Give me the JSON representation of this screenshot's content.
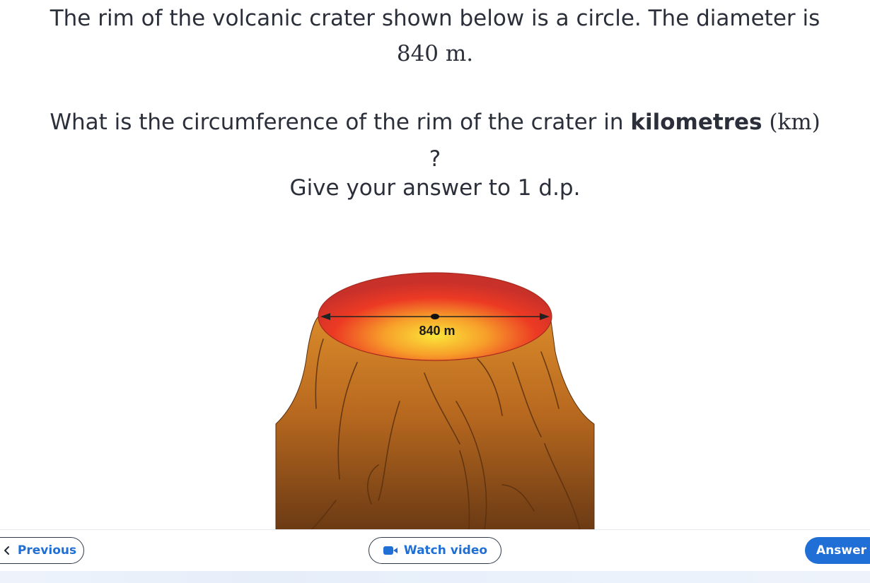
{
  "question": {
    "line1": "The rim of the volcanic crater shown below is a circle. The diameter is",
    "diameter_value": "840 m.",
    "prompt_start": "What is the circumference of the rim of the crater in ",
    "unit_word": "kilometres",
    "unit_symbol": "(km)",
    "question_mark": "?",
    "instruction": "Give your answer to 1 d.p."
  },
  "diagram": {
    "diameter_label": "840 m",
    "colors": {
      "lava_outer": "#d8322a",
      "lava_inner": "#fbe53a",
      "rock_light": "#d98a2a",
      "rock_dark": "#6b3a14"
    }
  },
  "footer": {
    "previous_label": "Previous",
    "video_label": "Watch video",
    "answer_label": "Answer"
  },
  "icons": {
    "previous": "chevron-left-icon",
    "video": "video-camera-icon"
  },
  "colors": {
    "accent": "#1f6fd6",
    "text": "#2a2f3a"
  }
}
